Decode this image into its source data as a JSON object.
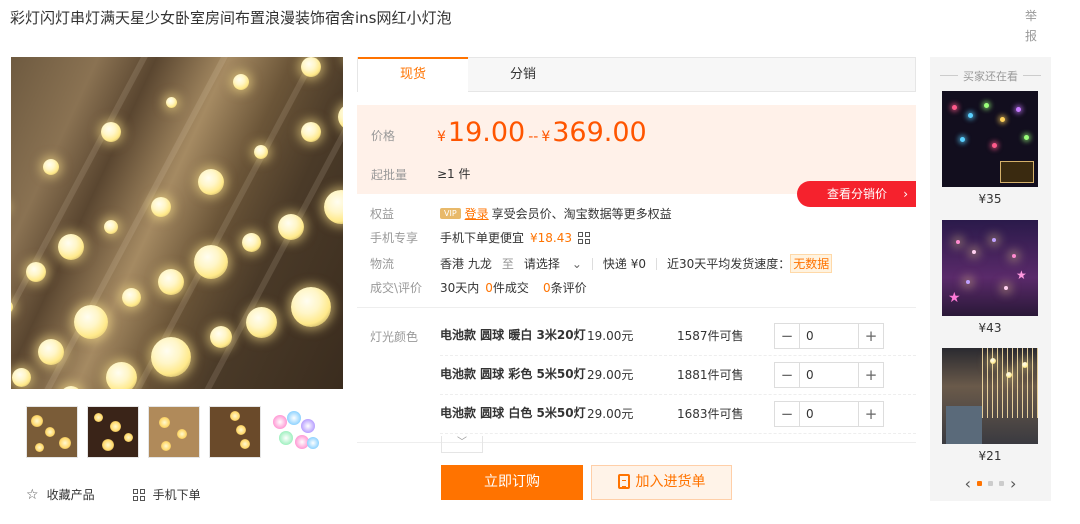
{
  "product": {
    "title": "彩灯闪灯串灯满天星少女卧室房间布置浪漫装饰宿舍ins网红小灯泡",
    "report_label": "举报"
  },
  "gallery": {
    "thumb_count": 5
  },
  "actions": {
    "favorite_label": "收藏产品",
    "mobile_order_label": "手机下单",
    "buy_label": "立即订购",
    "cart_label": "加入进货单"
  },
  "tabs": [
    {
      "label": "现货",
      "active": true
    },
    {
      "label": "分销",
      "active": false
    }
  ],
  "price": {
    "label": "价格",
    "currency": "¥",
    "low": "19.00",
    "dash": "--",
    "high": "369.00",
    "moq_label": "起批量",
    "moq_value": "≥1 件"
  },
  "distribution_button": "查看分销价",
  "rights": {
    "label": "权益",
    "vip": "VIP",
    "login": "登录",
    "text": "享受会员价、淘宝数据等更多权益"
  },
  "mobile": {
    "label": "手机专享",
    "text": "手机下单更便宜",
    "price": "¥18.43"
  },
  "logistics": {
    "label": "物流",
    "origin": "香港 九龙",
    "to": "至",
    "select": "请选择",
    "express": "快递 ¥0",
    "speed_label": "近30天平均发货速度：",
    "speed_value": "无数据"
  },
  "trade": {
    "label": "成交\\评价",
    "prefix": "30天内",
    "orders": "0",
    "orders_suffix": "件成交",
    "reviews": "0",
    "reviews_suffix": "条评价"
  },
  "sku": {
    "label": "灯光颜色",
    "items": [
      {
        "name": "电池款 圆球 暖白 3米20灯",
        "price": "19.00元",
        "stock": "1587件可售",
        "qty": "0"
      },
      {
        "name": "电池款 圆球 彩色 5米50灯",
        "price": "29.00元",
        "stock": "1881件可售",
        "qty": "0"
      },
      {
        "name": "电池款 圆球 白色 5米50灯",
        "price": "29.00元",
        "stock": "1683件可售",
        "qty": "0"
      }
    ],
    "minus": "−",
    "plus": "+",
    "expand": "﹀"
  },
  "sidebar": {
    "title": "买家还在看",
    "items": [
      {
        "price": "¥35"
      },
      {
        "price": "¥43"
      },
      {
        "price": "¥21"
      }
    ],
    "prev": "‹",
    "next": "›"
  },
  "colors": {
    "accent": "#ff7300",
    "price": "#ff5500",
    "red_button": "#f5222d"
  }
}
